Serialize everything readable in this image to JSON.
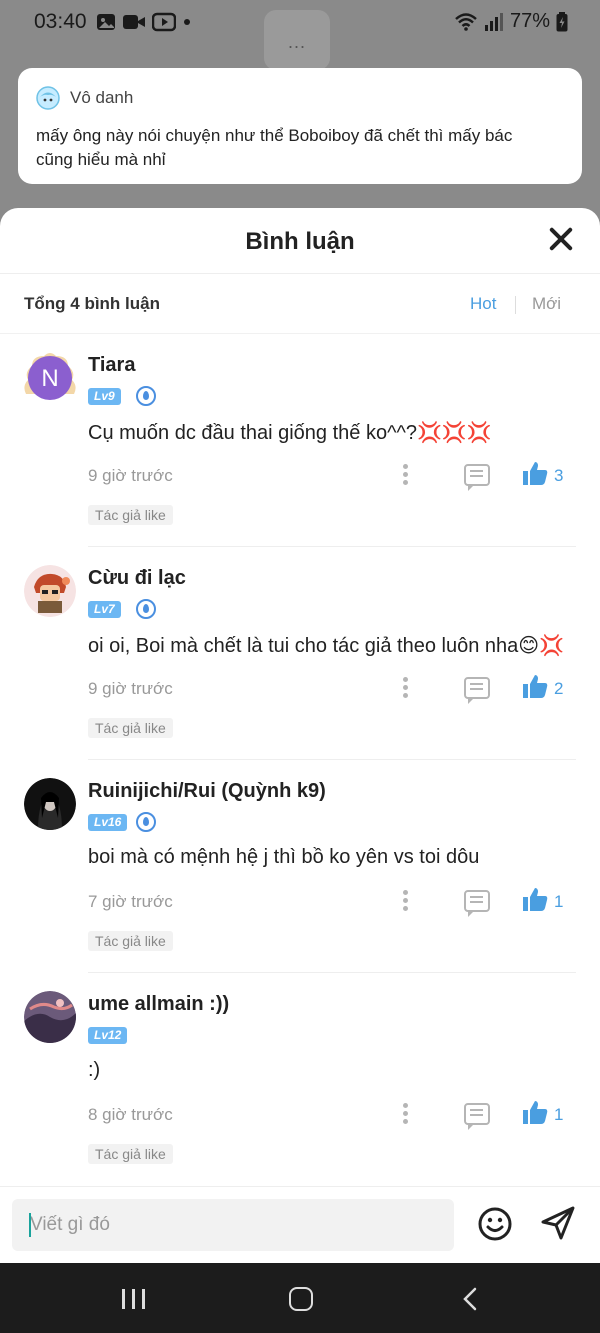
{
  "status_bar": {
    "time": "03:40",
    "battery": "77%"
  },
  "top_tab": {
    "label": "..."
  },
  "preview": {
    "author": "Vô danh",
    "text_line1": "mấy ông này nói chuyện như thể Boboiboy đã chết thì mấy bác",
    "text_line2": "cũng hiểu mà nhỉ"
  },
  "sheet": {
    "title": "Bình luận",
    "count_label": "Tổng 4 bình luận",
    "sort_hot": "Hot",
    "sort_new": "Mới"
  },
  "comments": [
    {
      "username": "Tiara",
      "level": "Lv9",
      "has_shield": true,
      "text": "Cụ muốn dc đầu thai giống thế ko^^?💢💢💢",
      "time": "9 giờ trước",
      "likes": "3",
      "author_like": "Tác giả like",
      "avatar_letter": "N"
    },
    {
      "username": "Cừu đi lạc",
      "level": "Lv7",
      "has_shield": true,
      "text": "oi oi, Boi mà chết là tui cho tác giả theo luôn nha😊💢",
      "time": "9 giờ trước",
      "likes": "2",
      "author_like": "Tác giả like"
    },
    {
      "username": "Ruinijichi/Rui (Quỳnh k9)",
      "level": "Lv16",
      "has_shield": true,
      "text": "boi mà có mệnh hệ j thì bồ ko yên vs toi dôu",
      "time": "7 giờ trước",
      "likes": "1",
      "author_like": "Tác giả like"
    },
    {
      "username": "ume allmain :))",
      "level": "Lv12",
      "has_shield": false,
      "text": ":)",
      "time": "8 giờ trước",
      "likes": "1",
      "author_like": "Tác giả like"
    }
  ],
  "composer": {
    "placeholder": "Viết gì đó"
  },
  "colors": {
    "accent_blue": "#4a9ee0",
    "level_badge": "#6cb7f3",
    "overlay": "#8a8a8a"
  }
}
